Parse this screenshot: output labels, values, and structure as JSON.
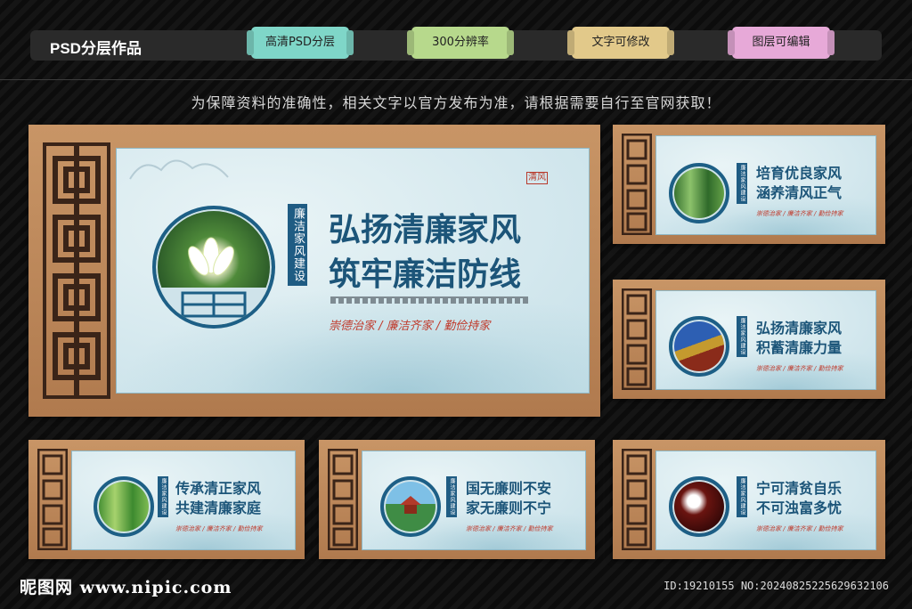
{
  "header": {
    "brand": "PSD分层作品",
    "tags": [
      {
        "label": "高清PSD分层",
        "color": "#7fd6c8"
      },
      {
        "label": "300分辨率",
        "color": "#b7d98c"
      },
      {
        "label": "文字可修改",
        "color": "#e2c98a"
      },
      {
        "label": "图层可编辑",
        "color": "#e7a9d8"
      }
    ]
  },
  "notice": "为保障资料的准确性，相关文字以官方发布为准，请根据需要自行至官网获取！",
  "main_board": {
    "vertical": "廉洁家风建设",
    "seal": "清风",
    "title_line1": "弘扬清廉家风",
    "title_line2": "筑牢廉洁防线",
    "slogan": "崇德治家 / 廉洁齐家 / 勤俭持家",
    "photo": "lotus"
  },
  "small_boards": [
    {
      "title_line1": "培育优良家风",
      "title_line2": "涵养清风正气",
      "slogan": "崇德治家 / 廉洁齐家 / 勤俭持家",
      "vertical": "廉洁家风建设",
      "photo": "bamboo"
    },
    {
      "title_line1": "弘扬清廉家风",
      "title_line2": "积蓄清廉力量",
      "slogan": "崇德治家 / 廉洁齐家 / 勤俭持家",
      "vertical": "廉洁家风建设",
      "photo": "roof"
    },
    {
      "title_line1": "传承清正家风",
      "title_line2": "共建清廉家庭",
      "slogan": "崇德治家 / 廉洁齐家 / 勤俭持家",
      "vertical": "廉洁家风建设",
      "photo": "bamboo-green"
    },
    {
      "title_line1": "国无廉则不安",
      "title_line2": "家无廉则不宁",
      "slogan": "崇德治家 / 廉洁齐家 / 勤俭持家",
      "vertical": "廉洁家风建设",
      "photo": "pavilion"
    },
    {
      "title_line1": "宁可清贫自乐",
      "title_line2": "不可浊富多忧",
      "slogan": "崇德治家 / 廉洁齐家 / 勤俭持家",
      "vertical": "廉洁家风建设",
      "photo": "flower"
    }
  ],
  "footer": {
    "left": "昵图网 www.nipic.com",
    "right": "ID:19210155 NO:20240825225629632106"
  }
}
